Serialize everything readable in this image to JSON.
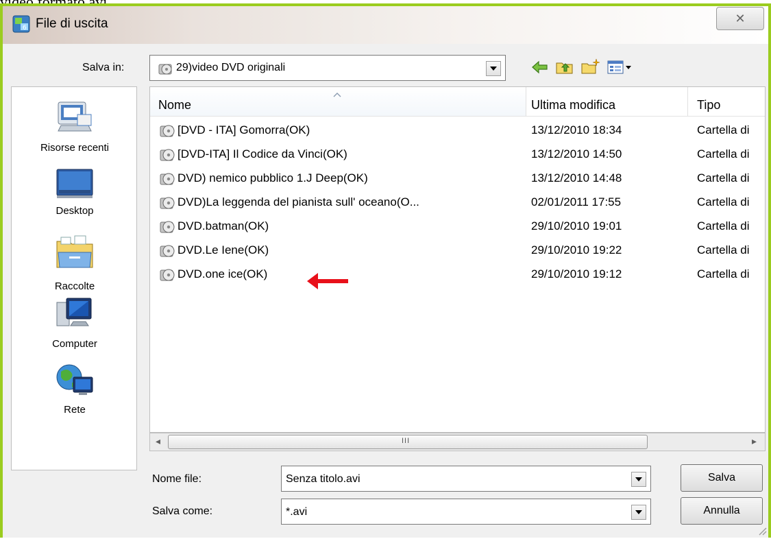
{
  "caption_text": "video formato avi",
  "window": {
    "title": "File di uscita",
    "close_glyph": "✕"
  },
  "toolbar": {
    "save_in_label": "Salva in:",
    "save_in_value": "29)video DVD originali",
    "icons": [
      "back-arrow-icon",
      "up-folder-icon",
      "new-folder-icon",
      "view-menu-icon"
    ]
  },
  "sidebar": {
    "items": [
      {
        "label": "Risorse recenti",
        "icon": "recent-places-icon"
      },
      {
        "label": "Desktop",
        "icon": "desktop-icon"
      },
      {
        "label": "Raccolte",
        "icon": "libraries-icon"
      },
      {
        "label": "Computer",
        "icon": "computer-icon"
      },
      {
        "label": "Rete",
        "icon": "network-icon"
      }
    ]
  },
  "file_list": {
    "columns": [
      "Nome",
      "Ultima modifica",
      "Tipo"
    ],
    "rows": [
      {
        "name": "[DVD - ITA] Gomorra(OK)",
        "modified": "13/12/2010 18:34",
        "type": "Cartella di"
      },
      {
        "name": "[DVD-ITA] Il Codice da Vinci(OK)",
        "modified": "13/12/2010 14:50",
        "type": "Cartella di"
      },
      {
        "name": "DVD) nemico pubblico 1.J Deep(OK)",
        "modified": "13/12/2010 14:48",
        "type": "Cartella di"
      },
      {
        "name": "DVD)La leggenda del pianista sull' oceano(O...",
        "modified": "02/01/2011 17:55",
        "type": "Cartella di"
      },
      {
        "name": "DVD.batman(OK)",
        "modified": "29/10/2010 19:01",
        "type": "Cartella di"
      },
      {
        "name": "DVD.Le Iene(OK)",
        "modified": "29/10/2010 19:22",
        "type": "Cartella di"
      },
      {
        "name": "DVD.one ice(OK)",
        "modified": "29/10/2010 19:12",
        "type": "Cartella di"
      }
    ],
    "annotation_color": "#e8101a"
  },
  "scrollbar": {
    "left_glyph": "◂",
    "right_glyph": "▸",
    "grip_glyph": "III"
  },
  "form": {
    "filename_label": "Nome file:",
    "filename_value": "Senza titolo.avi",
    "savetype_label": "Salva come:",
    "savetype_value": "*.avi",
    "save_button": "Salva",
    "cancel_button": "Annulla"
  },
  "colors": {
    "frame": "#9bcc1f",
    "window": "#f0f0f0"
  }
}
